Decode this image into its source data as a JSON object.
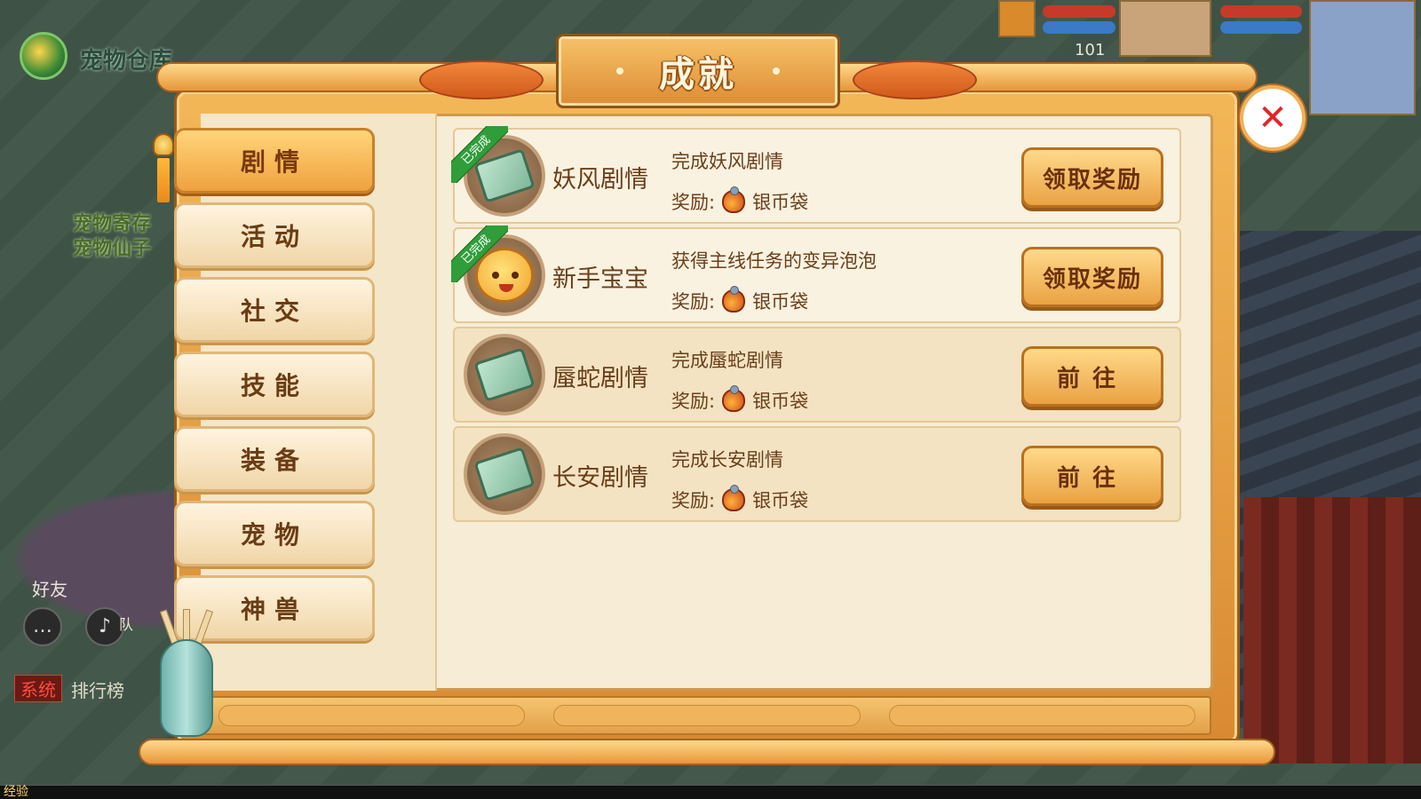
{
  "hud": {
    "pet_store": "宠物仓库",
    "npc_line1": "宠物寄存",
    "npc_line2": "宠物仙子",
    "player_level": "101",
    "friend_label": "好友",
    "team_label": "队",
    "system_tag": "系统",
    "rank_label": "排行榜",
    "exp_label": "经验"
  },
  "dialog": {
    "title": "成就",
    "close_icon": "close-x-icon"
  },
  "tabs": [
    {
      "label": "剧情",
      "active": true
    },
    {
      "label": "活动",
      "active": false
    },
    {
      "label": "社交",
      "active": false
    },
    {
      "label": "技能",
      "active": false
    },
    {
      "label": "装备",
      "active": false
    },
    {
      "label": "宠物",
      "active": false
    },
    {
      "label": "神兽",
      "active": false
    }
  ],
  "achievements": [
    {
      "title": "妖风剧情",
      "desc": "完成妖风剧情",
      "reward_prefix": "奖励:",
      "reward_item": "银币袋",
      "action": "领取奖励",
      "completed": true,
      "badge": "已完成",
      "icon": "scroll-icon"
    },
    {
      "title": "新手宝宝",
      "desc": "获得主线任务的变异泡泡",
      "reward_prefix": "奖励:",
      "reward_item": "银币袋",
      "action": "领取奖励",
      "completed": true,
      "badge": "已完成",
      "icon": "baby-face-icon"
    },
    {
      "title": "蜃蛇剧情",
      "desc": "完成蜃蛇剧情",
      "reward_prefix": "奖励:",
      "reward_item": "银币袋",
      "action": "前往",
      "completed": false,
      "icon": "scroll-icon"
    },
    {
      "title": "长安剧情",
      "desc": "完成长安剧情",
      "reward_prefix": "奖励:",
      "reward_item": "银币袋",
      "action": "前往",
      "completed": false,
      "icon": "scroll-icon"
    }
  ],
  "colors": {
    "frame": "#e7963a",
    "active_tab": "#f0a13e",
    "text_brown": "#6a3e1a",
    "close_red": "#e0262a",
    "done_green": "#2f9e3a"
  }
}
